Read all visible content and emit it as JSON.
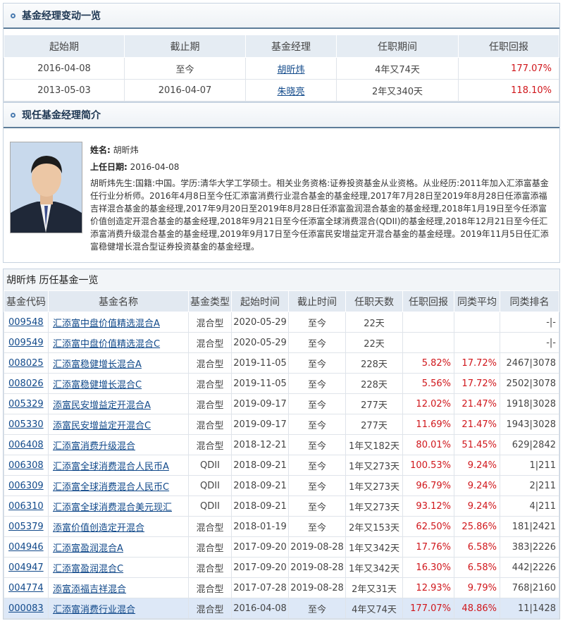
{
  "section1": {
    "title": "基金经理变动一览",
    "headers": [
      "起始期",
      "截止期",
      "基金经理",
      "任职期间",
      "任职回报"
    ],
    "rows": [
      {
        "start": "2016-04-08",
        "end": "至今",
        "manager": "胡昕炜",
        "period": "4年又74天",
        "return": "177.07%"
      },
      {
        "start": "2013-05-03",
        "end": "2016-04-07",
        "manager": "朱晓亮",
        "period": "2年又340天",
        "return": "118.10%"
      }
    ]
  },
  "section2": {
    "title": "现任基金经理简介",
    "name_label": "姓名:",
    "name": "胡昕炜",
    "date_label": "上任日期:",
    "date": "2016-04-08",
    "bio": "胡昕炜先生:国籍:中国。学历:清华大学工学硕士。相关业务资格:证券投资基金从业资格。从业经历:2011年加入汇添富基金任行业分析师。2016年4月8日至今任汇添富消费行业混合基金的基金经理,2017年7月28日至2019年8月28日任添富添福吉祥混合基金的基金经理,2017年9月20日至2019年8月28日任添富盈润混合基金的基金经理,2018年1月19日至今任添富价值创造定开混合基金的基金经理,2018年9月21日至今任添富全球消费混合(QDII)的基金经理,2018年12月21日至今任汇添富消费升级混合基金的基金经理,2019年9月17日至今任添富民安增益定开混合基金的基金经理。2019年11月5日任汇添富稳健增长混合型证券投资基金的基金经理。"
  },
  "section3": {
    "title": "胡昕炜 历任基金一览",
    "headers": [
      "基金代码",
      "基金名称",
      "基金类型",
      "起始时间",
      "截止时间",
      "任职天数",
      "任职回报",
      "同类平均",
      "同类排名"
    ],
    "rows": [
      {
        "code": "009548",
        "name": "汇添富中盘价值精选混合A",
        "type": "混合型",
        "start": "2020-05-29",
        "end": "至今",
        "days": "22天",
        "ret": "",
        "avg": "",
        "rank": "-|-"
      },
      {
        "code": "009549",
        "name": "汇添富中盘价值精选混合C",
        "type": "混合型",
        "start": "2020-05-29",
        "end": "至今",
        "days": "22天",
        "ret": "",
        "avg": "",
        "rank": "-|-"
      },
      {
        "code": "008025",
        "name": "汇添富稳健增长混合A",
        "type": "混合型",
        "start": "2019-11-05",
        "end": "至今",
        "days": "228天",
        "ret": "5.82%",
        "avg": "17.72%",
        "rank": "2467|3078"
      },
      {
        "code": "008026",
        "name": "汇添富稳健增长混合C",
        "type": "混合型",
        "start": "2019-11-05",
        "end": "至今",
        "days": "228天",
        "ret": "5.56%",
        "avg": "17.72%",
        "rank": "2502|3078"
      },
      {
        "code": "005329",
        "name": "添富民安增益定开混合A",
        "type": "混合型",
        "start": "2019-09-17",
        "end": "至今",
        "days": "277天",
        "ret": "12.02%",
        "avg": "21.47%",
        "rank": "1918|3028"
      },
      {
        "code": "005330",
        "name": "添富民安增益定开混合C",
        "type": "混合型",
        "start": "2019-09-17",
        "end": "至今",
        "days": "277天",
        "ret": "11.69%",
        "avg": "21.47%",
        "rank": "1943|3028"
      },
      {
        "code": "006408",
        "name": "汇添富消费升级混合",
        "type": "混合型",
        "start": "2018-12-21",
        "end": "至今",
        "days": "1年又182天",
        "ret": "80.01%",
        "avg": "51.45%",
        "rank": "629|2842"
      },
      {
        "code": "006308",
        "name": "汇添富全球消费混合人民币A",
        "type": "QDII",
        "start": "2018-09-21",
        "end": "至今",
        "days": "1年又273天",
        "ret": "100.53%",
        "avg": "9.24%",
        "rank": "1|211"
      },
      {
        "code": "006309",
        "name": "汇添富全球消费混合人民币C",
        "type": "QDII",
        "start": "2018-09-21",
        "end": "至今",
        "days": "1年又273天",
        "ret": "96.79%",
        "avg": "9.24%",
        "rank": "2|211"
      },
      {
        "code": "006310",
        "name": "汇添富全球消费混合美元现汇",
        "type": "QDII",
        "start": "2018-09-21",
        "end": "至今",
        "days": "1年又273天",
        "ret": "93.12%",
        "avg": "9.24%",
        "rank": "4|211"
      },
      {
        "code": "005379",
        "name": "添富价值创造定开混合",
        "type": "混合型",
        "start": "2018-01-19",
        "end": "至今",
        "days": "2年又153天",
        "ret": "62.50%",
        "avg": "25.86%",
        "rank": "181|2421"
      },
      {
        "code": "004946",
        "name": "汇添富盈润混合A",
        "type": "混合型",
        "start": "2017-09-20",
        "end": "2019-08-28",
        "days": "1年又342天",
        "ret": "17.76%",
        "avg": "6.58%",
        "rank": "383|2226"
      },
      {
        "code": "004947",
        "name": "汇添富盈润混合C",
        "type": "混合型",
        "start": "2017-09-20",
        "end": "2019-08-28",
        "days": "1年又342天",
        "ret": "16.30%",
        "avg": "6.58%",
        "rank": "442|2226"
      },
      {
        "code": "004774",
        "name": "添富添福吉祥混合",
        "type": "混合型",
        "start": "2017-07-28",
        "end": "2019-08-28",
        "days": "2年又31天",
        "ret": "12.93%",
        "avg": "9.79%",
        "rank": "768|2160"
      },
      {
        "code": "000083",
        "name": "汇添富消费行业混合",
        "type": "混合型",
        "start": "2016-04-08",
        "end": "至今",
        "days": "4年又74天",
        "ret": "177.07%",
        "avg": "48.86%",
        "rank": "11|1428"
      }
    ]
  }
}
